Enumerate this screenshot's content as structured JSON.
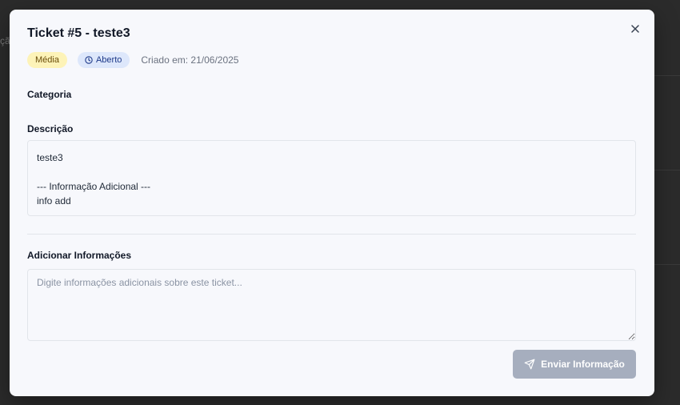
{
  "backdrop": {
    "fragment": "çã"
  },
  "modal": {
    "title": "Ticket #5 - teste3",
    "badges": {
      "priority": "Média",
      "status": "Aberto"
    },
    "created": "Criado em: 21/06/2025",
    "category_label": "Categoria",
    "description_label": "Descrição",
    "description_text": "teste3\n\n--- Informação Adicional ---\ninfo add",
    "add_info_label": "Adicionar Informações",
    "add_info_placeholder": "Digite informações adicionais sobre este ticket...",
    "send_button_label": "Enviar Informação"
  },
  "icons": {
    "close": "close-icon",
    "status": "clock-icon",
    "send": "send-icon"
  },
  "colors": {
    "priority_badge_bg": "#fdf3b8",
    "status_badge_bg": "#dde7fb",
    "send_button_bg": "#a6aebe"
  }
}
